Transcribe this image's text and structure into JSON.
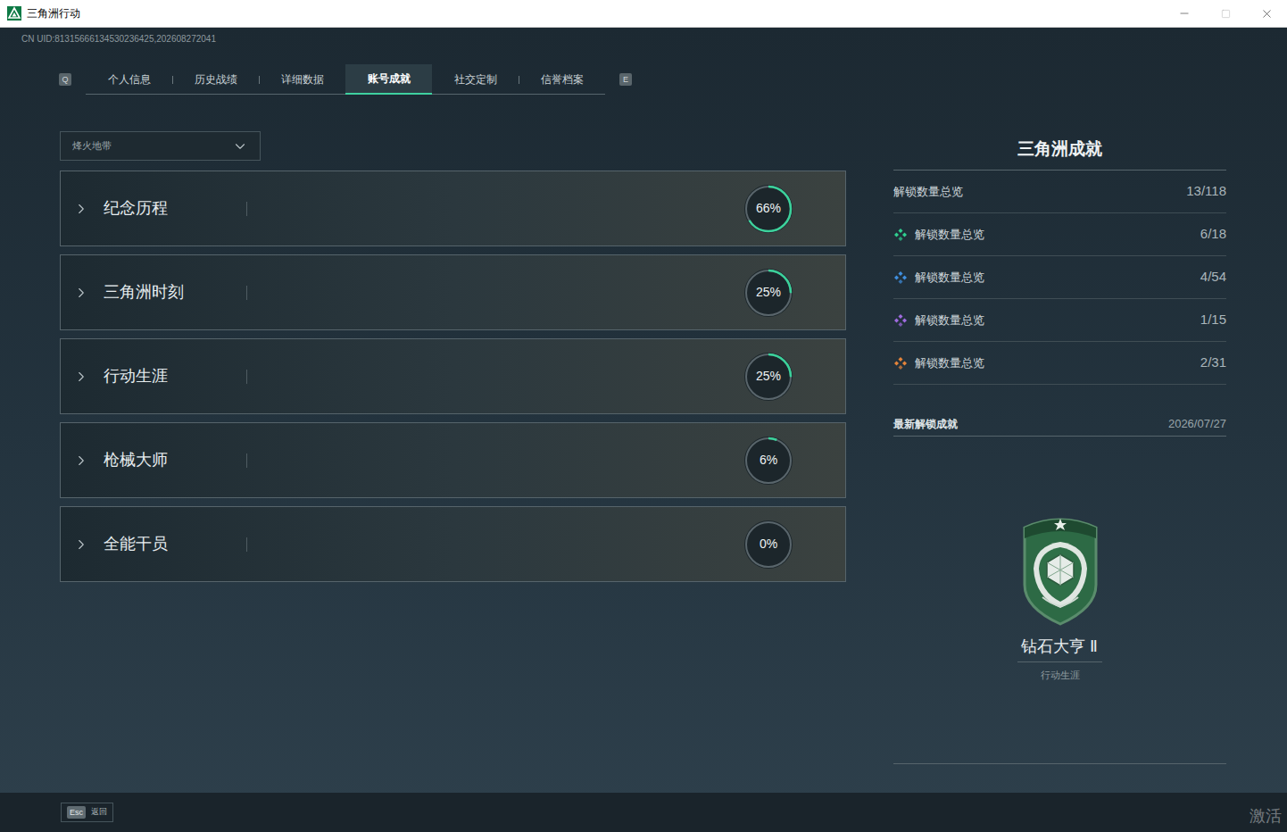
{
  "window": {
    "title": "三角洲行动"
  },
  "uid": "CN UID:81315666134530236425,202608272041",
  "tab_keys": {
    "prev": "Q",
    "next": "E"
  },
  "tabs": [
    {
      "label": "个人信息",
      "selected": false
    },
    {
      "label": "历史战绩",
      "selected": false
    },
    {
      "label": "详细数据",
      "selected": false
    },
    {
      "label": "账号成就",
      "selected": true
    },
    {
      "label": "社交定制",
      "selected": false
    },
    {
      "label": "信誉档案",
      "selected": false
    }
  ],
  "mode_select": {
    "value": "烽火地带",
    "expanded": false
  },
  "categories": [
    {
      "name": "纪念历程",
      "percent": "66%",
      "level": 0.66
    },
    {
      "name": "三角洲时刻",
      "percent": "25%",
      "level": 0.25
    },
    {
      "name": "行动生涯",
      "percent": "25%",
      "level": 0.25
    },
    {
      "name": "枪械大师",
      "percent": "6%",
      "level": 0.06
    },
    {
      "name": "全能干员",
      "percent": "0%",
      "level": 0
    }
  ],
  "summary": {
    "title": "三角洲成就",
    "total": {
      "label": "解锁数量总览",
      "value": "13/118"
    },
    "tiers": [
      {
        "label": "解锁数量总览",
        "value": "6/18",
        "color": "#2fd08f"
      },
      {
        "label": "解锁数量总览",
        "value": "4/54",
        "color": "#3f8fe0"
      },
      {
        "label": "解锁数量总览",
        "value": "1/15",
        "color": "#a06be0"
      },
      {
        "label": "解锁数量总览",
        "value": "2/31",
        "color": "#e5843a"
      }
    ]
  },
  "latest": {
    "heading": "最新解锁成就",
    "date": "2026/07/27",
    "name": "钻石大亨 Ⅱ",
    "category": "行动生涯"
  },
  "footer": {
    "key": "Esc",
    "label": "返回"
  },
  "watermark": "激活"
}
